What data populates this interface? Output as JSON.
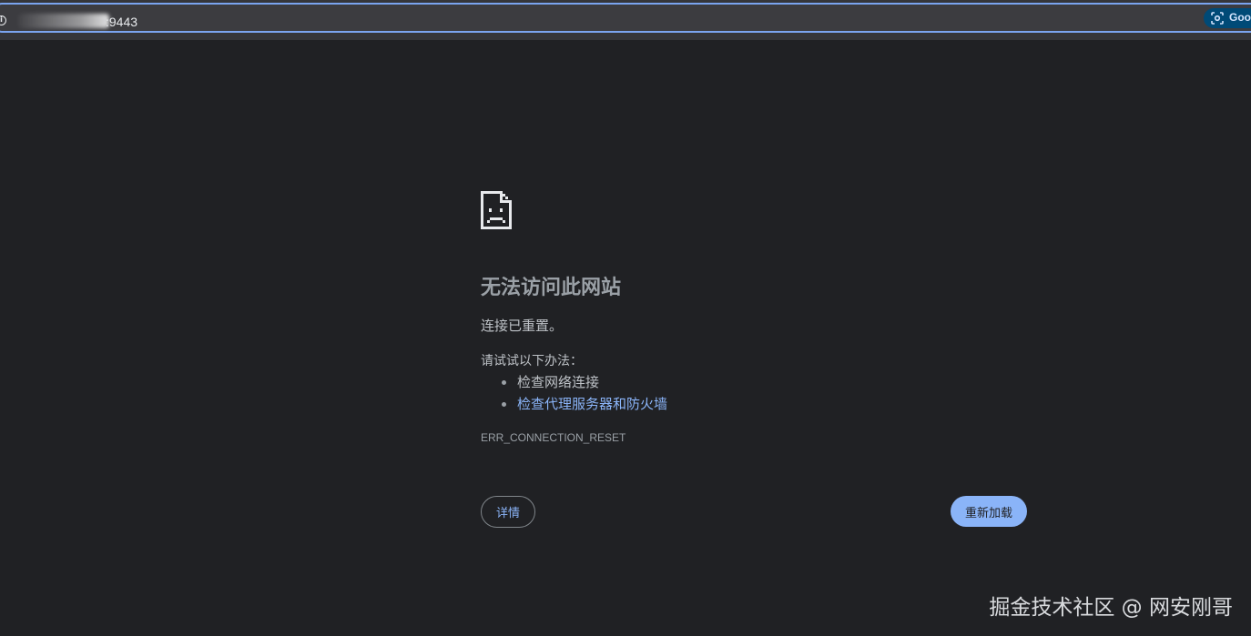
{
  "address_bar": {
    "url_visible": ":9443",
    "lens_label": "Goo"
  },
  "error": {
    "title": "无法访问此网站",
    "message": "连接已重置。",
    "suggestions_heading": "请试试以下办法：",
    "suggestions": [
      {
        "text": "检查网络连接",
        "is_link": false
      },
      {
        "text": "检查代理服务器和防火墙",
        "is_link": true
      }
    ],
    "code": "ERR_CONNECTION_RESET"
  },
  "buttons": {
    "details_label": "详情",
    "reload_label": "重新加载"
  },
  "watermark": "掘金技术社区 @ 网安刚哥",
  "colors": {
    "background": "#202124",
    "title": "#9aa0a6",
    "text": "#bdc1c6",
    "link": "#8ab4f8",
    "reload_button": "#8ab4f8",
    "omnibox_focus": "#7aa4ef"
  }
}
